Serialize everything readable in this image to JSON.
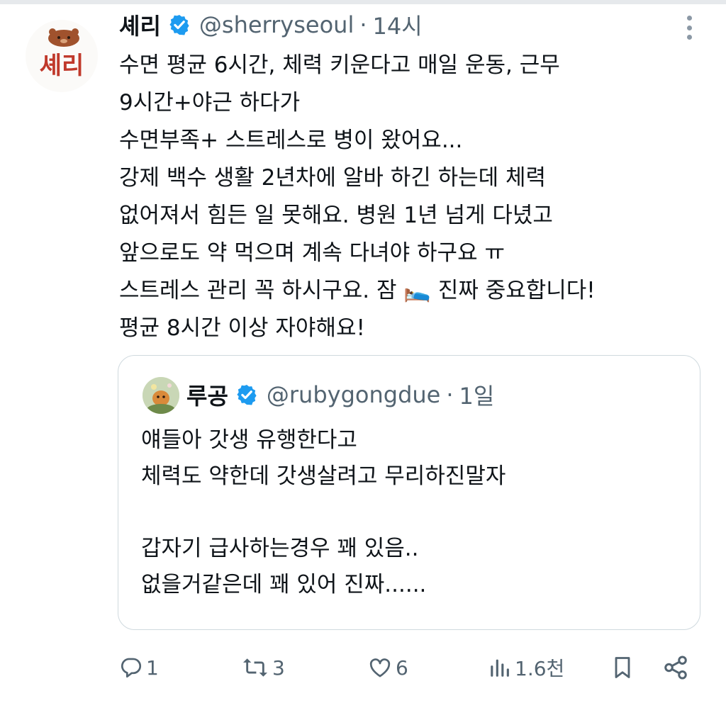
{
  "tweet": {
    "author_name": "셰리",
    "handle": "@sherryseoul",
    "time": "14시",
    "separator": "·",
    "avatar_text": "셰리",
    "lines": [
      "수면 평균 6시간, 체력 키운다고 매일 운동, 근무",
      "9시간+야근 하다가",
      "수면부족+ 스트레스로 병이 왔어요...",
      "강제 백수 생활 2년차에 알바 하긴 하는데 체력",
      "없어져서 힘든 일 못해요.  병원 1년 넘게 다녔고",
      "앞으로도 약 먹으며 계속 다녀야 하구요 ㅠ",
      "스트레스 관리 꼭 하시구요. 잠 🛌 진짜 중요합니다!",
      "평균 8시간 이상 자야해요!"
    ]
  },
  "quoted": {
    "author_name": "루공",
    "handle": "@rubygongdue",
    "time": "1일",
    "separator": "·",
    "lines": [
      "얘들아 갓생 유행한다고",
      "체력도 약한데 갓생살려고 무리하진말자",
      "",
      "갑자기 급사하는경우 꽤 있음..",
      "없을거같은데 꽤 있어 진짜......"
    ]
  },
  "actions": {
    "replies": "1",
    "reposts": "3",
    "likes": "6",
    "views": "1.6천"
  },
  "colors": {
    "verified": "#1d9bf0",
    "text": "#0f1419",
    "secondary": "#536471",
    "border": "#cfd9de",
    "avatar_text": "#c0392b"
  },
  "icons": [
    "verified-badge-icon",
    "more-options-icon",
    "reply-icon",
    "repost-icon",
    "like-icon",
    "views-icon",
    "bookmark-icon",
    "share-icon"
  ]
}
